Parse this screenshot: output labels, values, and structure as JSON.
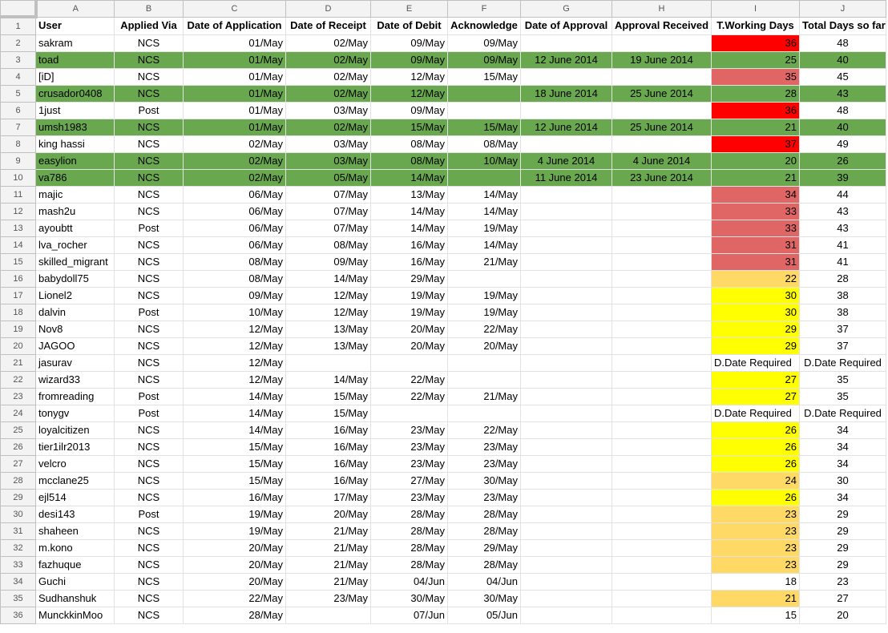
{
  "colors": {
    "approved": "#6aa84f",
    "red": "#ff0000",
    "light_red": "#e06666",
    "orange": "#ffd966",
    "yellow": "#ffff00",
    "none": ""
  },
  "columns": [
    "A",
    "B",
    "C",
    "D",
    "E",
    "F",
    "G",
    "H",
    "I",
    "J"
  ],
  "header_row_number": "1",
  "headers": [
    "User",
    "Applied Via",
    "Date of Application",
    "Date of Receipt",
    "Date of Debit",
    "Acknowledge",
    "Date of Approval",
    "Approval Received",
    "T.Working Days",
    "Total Days so far"
  ],
  "rows": [
    {
      "n": "2",
      "user": "sakram",
      "via": "NCS",
      "app": "01/May",
      "rec": "02/May",
      "debit": "09/May",
      "ack": "09/May",
      "appr": "",
      "recv": "",
      "twd": "36",
      "total": "48",
      "approved": false,
      "twd_color": "red"
    },
    {
      "n": "3",
      "user": "toad",
      "via": "NCS",
      "app": "01/May",
      "rec": "02/May",
      "debit": "09/May",
      "ack": "09/May",
      "appr": "12 June 2014",
      "recv": "19 June 2014",
      "twd": "25",
      "total": "40",
      "approved": true,
      "twd_color": "none"
    },
    {
      "n": "4",
      "user": "[iD]",
      "via": "NCS",
      "app": "01/May",
      "rec": "02/May",
      "debit": "12/May",
      "ack": "15/May",
      "appr": "",
      "recv": "",
      "twd": "35",
      "total": "45",
      "approved": false,
      "twd_color": "light_red"
    },
    {
      "n": "5",
      "user": "crusador0408",
      "via": "NCS",
      "app": "01/May",
      "rec": "02/May",
      "debit": "12/May",
      "ack": "",
      "appr": "18 June 2014",
      "recv": "25 June 2014",
      "twd": "28",
      "total": "43",
      "approved": true,
      "twd_color": "none"
    },
    {
      "n": "6",
      "user": "1just",
      "via": "Post",
      "app": "01/May",
      "rec": "03/May",
      "debit": "09/May",
      "ack": "",
      "appr": "",
      "recv": "",
      "twd": "36",
      "total": "48",
      "approved": false,
      "twd_color": "red"
    },
    {
      "n": "7",
      "user": "umsh1983",
      "via": "NCS",
      "app": "01/May",
      "rec": "02/May",
      "debit": "15/May",
      "ack": "15/May",
      "appr": "12 June 2014",
      "recv": "25 June 2014",
      "twd": "21",
      "total": "40",
      "approved": true,
      "twd_color": "none"
    },
    {
      "n": "8",
      "user": "king hassi",
      "via": "NCS",
      "app": "02/May",
      "rec": "03/May",
      "debit": "08/May",
      "ack": "08/May",
      "appr": "",
      "recv": "",
      "twd": "37",
      "total": "49",
      "approved": false,
      "twd_color": "red"
    },
    {
      "n": "9",
      "user": "easylion",
      "via": "NCS",
      "app": "02/May",
      "rec": "03/May",
      "debit": "08/May",
      "ack": "10/May",
      "appr": "4 June 2014",
      "recv": "4 June 2014",
      "twd": "20",
      "total": "26",
      "approved": true,
      "twd_color": "none"
    },
    {
      "n": "10",
      "user": "va786",
      "via": "NCS",
      "app": "02/May",
      "rec": "05/May",
      "debit": "14/May",
      "ack": "",
      "appr": "11 June 2014",
      "recv": "23 June 2014",
      "twd": "21",
      "total": "39",
      "approved": true,
      "twd_color": "none"
    },
    {
      "n": "11",
      "user": "majic",
      "via": "NCS",
      "app": "06/May",
      "rec": "07/May",
      "debit": "13/May",
      "ack": "14/May",
      "appr": "",
      "recv": "",
      "twd": "34",
      "total": "44",
      "approved": false,
      "twd_color": "light_red"
    },
    {
      "n": "12",
      "user": "mash2u",
      "via": "NCS",
      "app": "06/May",
      "rec": "07/May",
      "debit": "14/May",
      "ack": "14/May",
      "appr": "",
      "recv": "",
      "twd": "33",
      "total": "43",
      "approved": false,
      "twd_color": "light_red"
    },
    {
      "n": "13",
      "user": "ayoubtt",
      "via": "Post",
      "app": "06/May",
      "rec": "07/May",
      "debit": "14/May",
      "ack": "19/May",
      "appr": "",
      "recv": "",
      "twd": "33",
      "total": "43",
      "approved": false,
      "twd_color": "light_red"
    },
    {
      "n": "14",
      "user": "lva_rocher",
      "via": "NCS",
      "app": "06/May",
      "rec": "08/May",
      "debit": "16/May",
      "ack": "14/May",
      "appr": "",
      "recv": "",
      "twd": "31",
      "total": "41",
      "approved": false,
      "twd_color": "light_red"
    },
    {
      "n": "15",
      "user": "skilled_migrant",
      "via": "NCS",
      "app": "08/May",
      "rec": "09/May",
      "debit": "16/May",
      "ack": "21/May",
      "appr": "",
      "recv": "",
      "twd": "31",
      "total": "41",
      "approved": false,
      "twd_color": "light_red"
    },
    {
      "n": "16",
      "user": "babydoll75",
      "via": "NCS",
      "app": "08/May",
      "rec": "14/May",
      "debit": "29/May",
      "ack": "",
      "appr": "",
      "recv": "",
      "twd": "22",
      "total": "28",
      "approved": false,
      "twd_color": "orange"
    },
    {
      "n": "17",
      "user": "Lionel2",
      "via": "NCS",
      "app": "09/May",
      "rec": "12/May",
      "debit": "19/May",
      "ack": "19/May",
      "appr": "",
      "recv": "",
      "twd": "30",
      "total": "38",
      "approved": false,
      "twd_color": "yellow"
    },
    {
      "n": "18",
      "user": "dalvin",
      "via": "Post",
      "app": "10/May",
      "rec": "12/May",
      "debit": "19/May",
      "ack": "19/May",
      "appr": "",
      "recv": "",
      "twd": "30",
      "total": "38",
      "approved": false,
      "twd_color": "yellow"
    },
    {
      "n": "19",
      "user": "Nov8",
      "via": "NCS",
      "app": "12/May",
      "rec": "13/May",
      "debit": "20/May",
      "ack": "22/May",
      "appr": "",
      "recv": "",
      "twd": "29",
      "total": "37",
      "approved": false,
      "twd_color": "yellow"
    },
    {
      "n": "20",
      "user": "JAGOO",
      "via": "NCS",
      "app": "12/May",
      "rec": "13/May",
      "debit": "20/May",
      "ack": "20/May",
      "appr": "",
      "recv": "",
      "twd": "29",
      "total": "37",
      "approved": false,
      "twd_color": "yellow"
    },
    {
      "n": "21",
      "user": "jasurav",
      "via": "NCS",
      "app": "12/May",
      "rec": "",
      "debit": "",
      "ack": "",
      "appr": "",
      "recv": "",
      "twd": "D.Date Required",
      "total": "D.Date Required",
      "approved": false,
      "twd_color": "none"
    },
    {
      "n": "22",
      "user": "wizard33",
      "via": "NCS",
      "app": "12/May",
      "rec": "14/May",
      "debit": "22/May",
      "ack": "",
      "appr": "",
      "recv": "",
      "twd": "27",
      "total": "35",
      "approved": false,
      "twd_color": "yellow"
    },
    {
      "n": "23",
      "user": "fromreading",
      "via": "Post",
      "app": "14/May",
      "rec": "15/May",
      "debit": "22/May",
      "ack": "21/May",
      "appr": "",
      "recv": "",
      "twd": "27",
      "total": "35",
      "approved": false,
      "twd_color": "yellow"
    },
    {
      "n": "24",
      "user": "tonygv",
      "via": "Post",
      "app": "14/May",
      "rec": "15/May",
      "debit": "",
      "ack": "",
      "appr": "",
      "recv": "",
      "twd": "D.Date Required",
      "total": "D.Date Required",
      "approved": false,
      "twd_color": "none"
    },
    {
      "n": "25",
      "user": "loyalcitizen",
      "via": "NCS",
      "app": "14/May",
      "rec": "16/May",
      "debit": "23/May",
      "ack": "22/May",
      "appr": "",
      "recv": "",
      "twd": "26",
      "total": "34",
      "approved": false,
      "twd_color": "yellow"
    },
    {
      "n": "26",
      "user": "tier1ilr2013",
      "via": "NCS",
      "app": "15/May",
      "rec": "16/May",
      "debit": "23/May",
      "ack": "23/May",
      "appr": "",
      "recv": "",
      "twd": "26",
      "total": "34",
      "approved": false,
      "twd_color": "yellow"
    },
    {
      "n": "27",
      "user": "velcro",
      "via": "NCS",
      "app": "15/May",
      "rec": "16/May",
      "debit": "23/May",
      "ack": "23/May",
      "appr": "",
      "recv": "",
      "twd": "26",
      "total": "34",
      "approved": false,
      "twd_color": "yellow"
    },
    {
      "n": "28",
      "user": "mcclane25",
      "via": "NCS",
      "app": "15/May",
      "rec": "16/May",
      "debit": "27/May",
      "ack": "30/May",
      "appr": "",
      "recv": "",
      "twd": "24",
      "total": "30",
      "approved": false,
      "twd_color": "orange"
    },
    {
      "n": "29",
      "user": "ejl514",
      "via": "NCS",
      "app": "16/May",
      "rec": "17/May",
      "debit": "23/May",
      "ack": "23/May",
      "appr": "",
      "recv": "",
      "twd": "26",
      "total": "34",
      "approved": false,
      "twd_color": "yellow"
    },
    {
      "n": "30",
      "user": "desi143",
      "via": "Post",
      "app": "19/May",
      "rec": "20/May",
      "debit": "28/May",
      "ack": "28/May",
      "appr": "",
      "recv": "",
      "twd": "23",
      "total": "29",
      "approved": false,
      "twd_color": "orange"
    },
    {
      "n": "31",
      "user": "shaheen",
      "via": "NCS",
      "app": "19/May",
      "rec": "21/May",
      "debit": "28/May",
      "ack": "28/May",
      "appr": "",
      "recv": "",
      "twd": "23",
      "total": "29",
      "approved": false,
      "twd_color": "orange"
    },
    {
      "n": "32",
      "user": "m.kono",
      "via": "NCS",
      "app": "20/May",
      "rec": "21/May",
      "debit": "28/May",
      "ack": "29/May",
      "appr": "",
      "recv": "",
      "twd": "23",
      "total": "29",
      "approved": false,
      "twd_color": "orange"
    },
    {
      "n": "33",
      "user": "fazhuque",
      "via": "NCS",
      "app": "20/May",
      "rec": "21/May",
      "debit": "28/May",
      "ack": "28/May",
      "appr": "",
      "recv": "",
      "twd": "23",
      "total": "29",
      "approved": false,
      "twd_color": "orange"
    },
    {
      "n": "34",
      "user": "Guchi",
      "via": "NCS",
      "app": "20/May",
      "rec": "21/May",
      "debit": "04/Jun",
      "ack": "04/Jun",
      "appr": "",
      "recv": "",
      "twd": "18",
      "total": "23",
      "approved": false,
      "twd_color": "none"
    },
    {
      "n": "35",
      "user": "Sudhanshuk",
      "via": "NCS",
      "app": "22/May",
      "rec": "23/May",
      "debit": "30/May",
      "ack": "30/May",
      "appr": "",
      "recv": "",
      "twd": "21",
      "total": "27",
      "approved": false,
      "twd_color": "orange"
    },
    {
      "n": "36",
      "user": "MunckkinMoo",
      "via": "NCS",
      "app": "28/May",
      "rec": "",
      "debit": "07/Jun",
      "ack": "05/Jun",
      "appr": "",
      "recv": "",
      "twd": "15",
      "total": "20",
      "approved": false,
      "twd_color": "none"
    }
  ]
}
